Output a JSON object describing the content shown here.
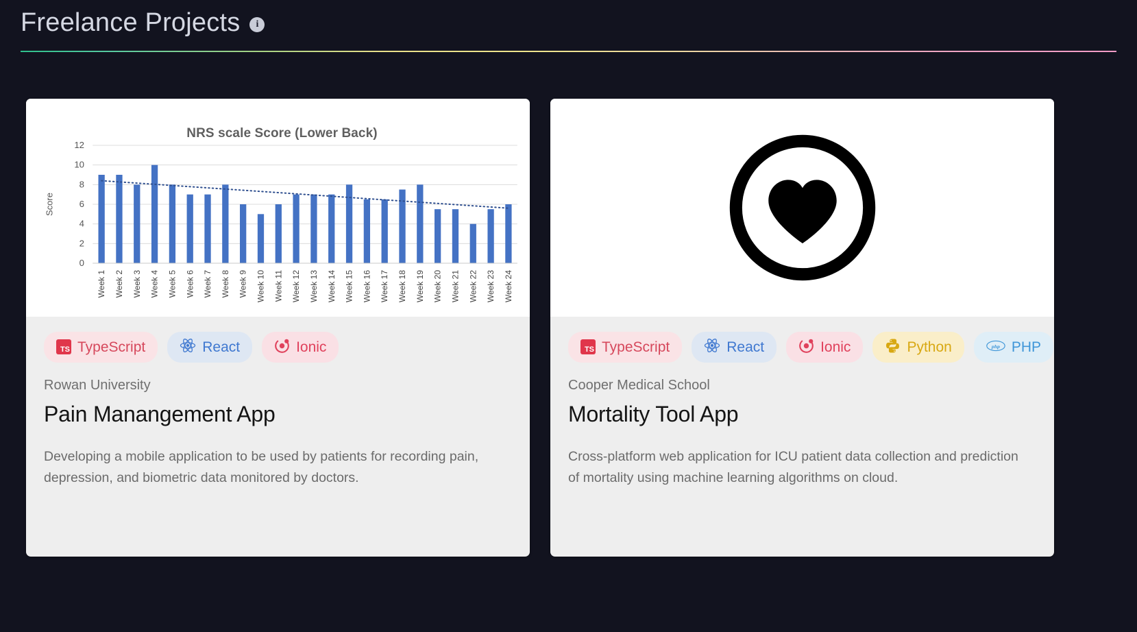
{
  "header": {
    "title": "Freelance Projects",
    "info_icon": "info-icon",
    "info_glyph": "i"
  },
  "cards": [
    {
      "media_type": "chart",
      "tags": [
        {
          "label": "TypeScript",
          "icon": "typescript-icon",
          "glyph": "TS",
          "color": "#d6485c",
          "bg": "#fae3e6"
        },
        {
          "label": "React",
          "icon": "react-icon",
          "color": "#3f78d0",
          "bg": "#dee7f3"
        },
        {
          "label": "Ionic",
          "icon": "ionic-icon",
          "color": "#e0415c",
          "bg": "#fae0e5"
        }
      ],
      "org": "Rowan University",
      "title": "Pain Manangement App",
      "description": "Developing a mobile application to be used by patients for recording pain, depression, and biometric data monitored by doctors."
    },
    {
      "media_type": "heart-logo",
      "media_icon": "heart-in-circle-icon",
      "tags": [
        {
          "label": "TypeScript",
          "icon": "typescript-icon",
          "glyph": "TS",
          "color": "#d6485c",
          "bg": "#fae3e6"
        },
        {
          "label": "React",
          "icon": "react-icon",
          "color": "#3f78d0",
          "bg": "#dee7f3"
        },
        {
          "label": "Ionic",
          "icon": "ionic-icon",
          "color": "#e0415c",
          "bg": "#fae0e5"
        },
        {
          "label": "Python",
          "icon": "python-icon",
          "color": "#d8a812",
          "bg": "#faeec9"
        },
        {
          "label": "PHP",
          "icon": "php-icon",
          "color": "#3f96d8",
          "bg": "#dfeef7"
        }
      ],
      "org": "Cooper Medical School",
      "title": "Mortality Tool App",
      "description": "Cross-platform web application for ICU patient data collection and prediction of mortality using machine learning algorithms on cloud."
    }
  ],
  "chart_data": {
    "type": "bar",
    "title": "NRS scale Score (Lower Back)",
    "xlabel": "",
    "ylabel": "Score",
    "ylim": [
      0,
      12
    ],
    "yticks": [
      0,
      2,
      4,
      6,
      8,
      10,
      12
    ],
    "grid": true,
    "legend": "none",
    "bar_color": "#4472c4",
    "trendline": {
      "style": "dotted",
      "color": "#2f4f8f",
      "start_value": 8.4,
      "end_value": 5.6
    },
    "categories": [
      "Week 1",
      "Week 2",
      "Week 3",
      "Week 4",
      "Week 5",
      "Week 6",
      "Week 7",
      "Week 8",
      "Week 9",
      "Week 10",
      "Week 11",
      "Week 12",
      "Week 13",
      "Week 14",
      "Week 15",
      "Week 16",
      "Week 17",
      "Week 18",
      "Week 19",
      "Week 20",
      "Week 21",
      "Week 22",
      "Week 23",
      "Week 24"
    ],
    "values": [
      9,
      9,
      8,
      10,
      8,
      7,
      7,
      8,
      6,
      5,
      6,
      7,
      7,
      7,
      8,
      6.5,
      6.5,
      7.5,
      8,
      5.5,
      5.5,
      4,
      5.5,
      6
    ]
  },
  "colors": {
    "page_background": "#12131f",
    "card_body_background": "#eeeeee",
    "card_media_background": "#ffffff",
    "title_text": "#d5d8e3"
  }
}
